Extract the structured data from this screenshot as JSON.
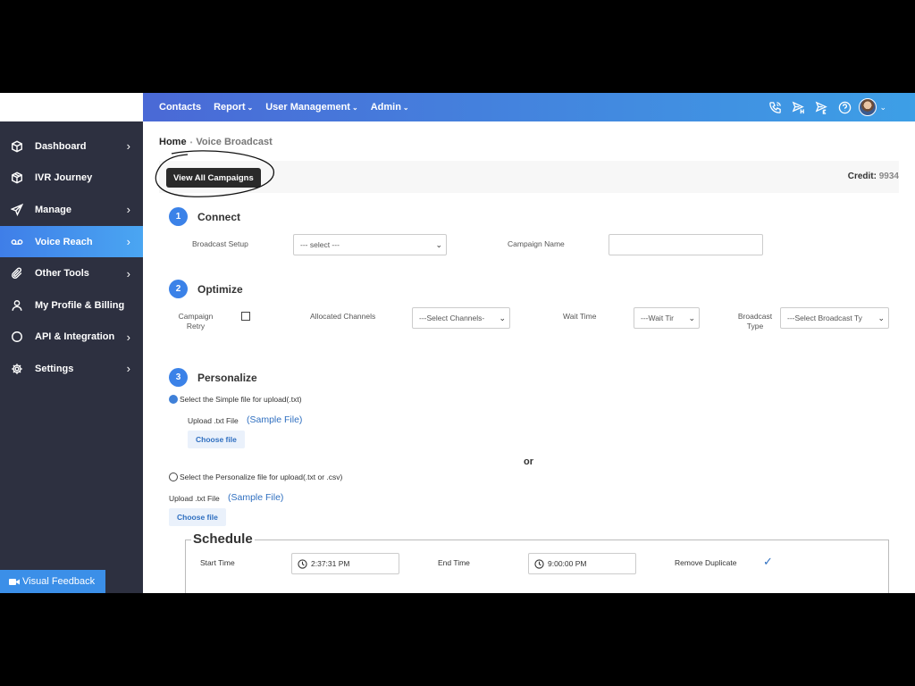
{
  "sidebar": {
    "items": [
      {
        "label": "Dashboard",
        "icon": "cube-icon",
        "chevron": true,
        "active": false
      },
      {
        "label": "IVR Journey",
        "icon": "box-icon",
        "chevron": false,
        "active": false
      },
      {
        "label": "Manage",
        "icon": "send-icon",
        "chevron": true,
        "active": false
      },
      {
        "label": "Voice Reach",
        "icon": "voicemail-icon",
        "chevron": true,
        "active": true
      },
      {
        "label": "Other Tools",
        "icon": "paperclip-icon",
        "chevron": true,
        "active": false
      },
      {
        "label": "My Profile & Billing",
        "icon": "user-icon",
        "chevron": false,
        "active": false
      },
      {
        "label": "API & Integration",
        "icon": "circle-icon",
        "chevron": true,
        "active": false
      },
      {
        "label": "Settings",
        "icon": "gear-icon",
        "chevron": true,
        "active": false
      }
    ],
    "feedback_label": "Visual Feedback"
  },
  "topnav": {
    "items": [
      "Contacts",
      "Report",
      "User Management",
      "Admin"
    ],
    "caret": "⌄",
    "icons": [
      "phone-call-icon",
      "send-h-icon",
      "send-en-icon",
      "help-icon"
    ]
  },
  "breadcrumb": {
    "home": "Home",
    "separator": "•",
    "current": "Voice Broadcast"
  },
  "card": {
    "view_all_label": "View All Campaigns",
    "credit_label": "Credit:",
    "credit_value": "9934"
  },
  "steps": {
    "connect": {
      "number": "1",
      "title": "Connect",
      "broadcast_setup_label": "Broadcast Setup",
      "broadcast_setup_value": "--- select ---",
      "campaign_name_label": "Campaign Name",
      "campaign_name_value": ""
    },
    "optimize": {
      "number": "2",
      "title": "Optimize",
      "campaign_retry_label_1": "Campaign",
      "campaign_retry_label_2": "Retry",
      "allocated_channels_label": "Allocated Channels",
      "allocated_channels_value": "---Select Channels-",
      "wait_time_label": "Wait Time",
      "wait_time_value": "---Wait Tir",
      "broadcast_type_label_1": "Broadcast",
      "broadcast_type_label_2": "Type",
      "broadcast_type_value": "---Select Broadcast Ty"
    },
    "personalize": {
      "number": "3",
      "title": "Personalize",
      "simple_radio_label": "Select the Simple file for upload(.txt)",
      "upload_label": "Upload .txt File",
      "sample_file": "(Sample File)",
      "choose_file": "Choose file",
      "or": "or",
      "personalize_radio_label": "Select the Personalize file for upload(.txt or .csv)"
    }
  },
  "schedule": {
    "title": "Schedule",
    "start_label": "Start Time",
    "start_value": "2:37:31 PM",
    "end_label": "End Time",
    "end_value": "9:00:00 PM",
    "remove_duplicate_label": "Remove Duplicate",
    "remove_duplicate_checked": "✓"
  },
  "colors": {
    "sidebar_bg": "#2d3040",
    "accent": "#3b82e8",
    "topbar_start": "#4a69d6",
    "topbar_end": "#3d9fe6"
  }
}
